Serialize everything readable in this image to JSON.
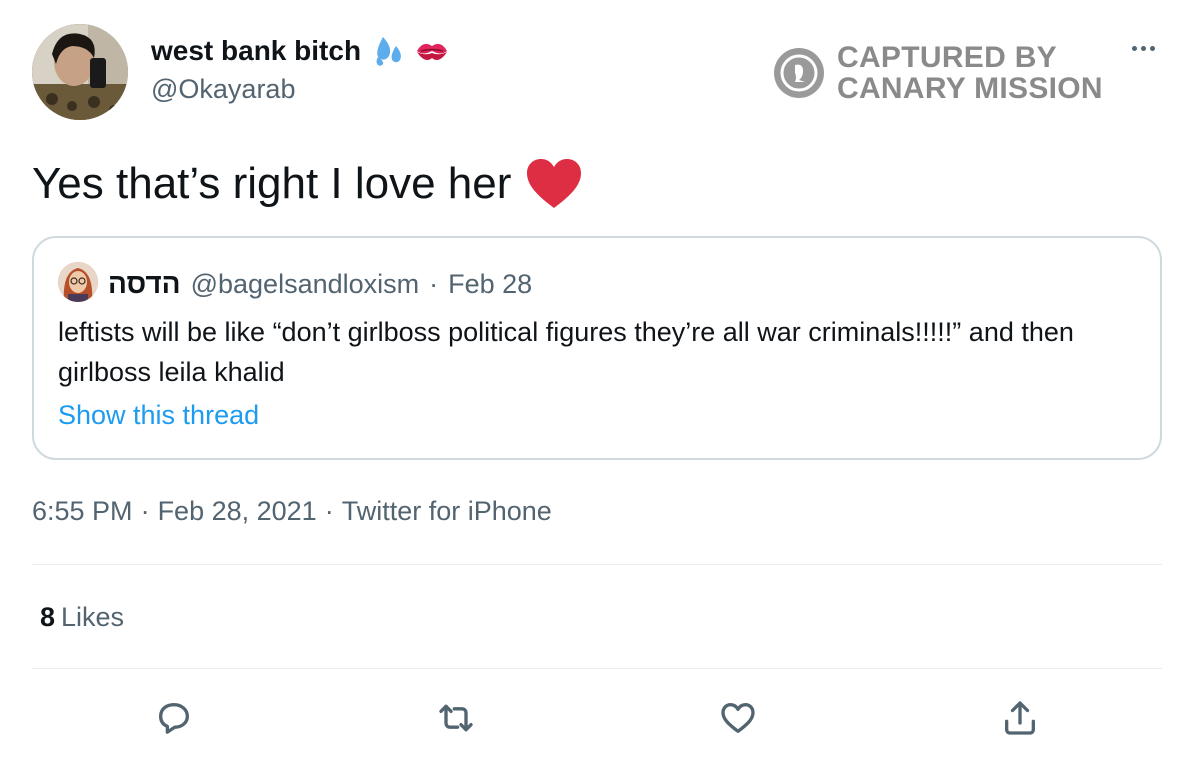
{
  "author": {
    "display_name": "west bank bitch",
    "handle": "@Okayarab",
    "name_emojis": [
      "sweat-droplets-emoji",
      "kiss-mark-emoji"
    ]
  },
  "watermark": {
    "line1": "CAPTURED BY",
    "line2": "CANARY MISSION"
  },
  "tweet": {
    "text": "Yes that’s right I love her",
    "emoji": "red-heart-emoji"
  },
  "quoted_tweet": {
    "name": "הדסה",
    "handle": "@bagelsandloxism",
    "separator": "·",
    "date": "Feb 28",
    "body": "leftists will be like “don’t girlboss political figures they’re all war criminals!!!!!” and then girlboss leila khalid",
    "show_thread": "Show this thread"
  },
  "meta": {
    "time": "6:55 PM",
    "sep1": "·",
    "date": "Feb 28, 2021",
    "sep2": "·",
    "source": "Twitter for iPhone"
  },
  "stats": {
    "likes_count": "8",
    "likes_label": "Likes"
  },
  "actions": [
    "reply-icon",
    "retweet-icon",
    "like-icon",
    "share-icon"
  ],
  "colors": {
    "text": "#0f1419",
    "secondary": "#536471",
    "link": "#1d9bf0",
    "border": "#cfd9de",
    "heart": "#e0245e",
    "watermark": "#8a8a8a"
  }
}
